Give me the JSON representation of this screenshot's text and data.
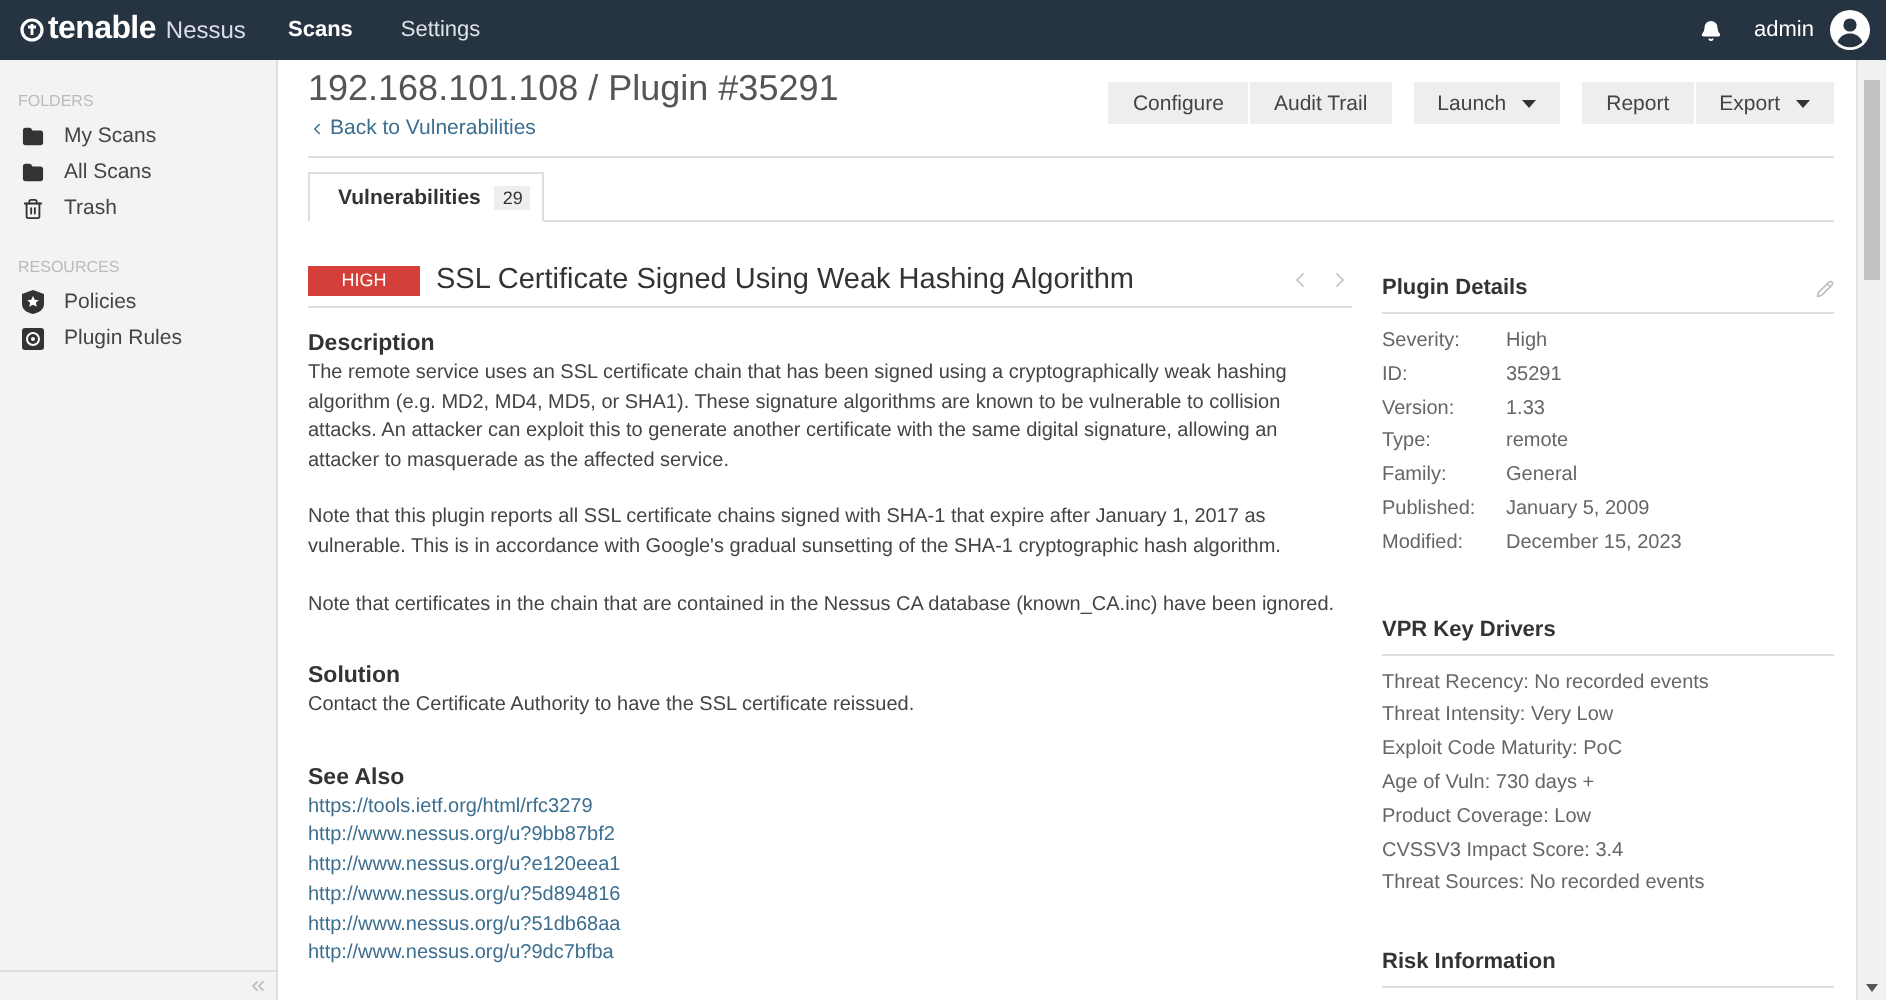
{
  "topbar": {
    "logo": {
      "brand": "tenable",
      "product": "Nessus"
    },
    "nav": [
      {
        "label": "Scans",
        "selected": true
      },
      {
        "label": "Settings",
        "selected": false
      }
    ],
    "user": "admin"
  },
  "sidebar": {
    "sections": [
      {
        "title": "FOLDERS",
        "items": [
          {
            "label": "My Scans",
            "kind": "folder"
          },
          {
            "label": "All Scans",
            "kind": "folder"
          },
          {
            "label": "Trash",
            "kind": "trash"
          }
        ]
      },
      {
        "title": "RESOURCES",
        "items": [
          {
            "label": "Policies",
            "kind": "shield"
          },
          {
            "label": "Plugin Rules",
            "kind": "rules"
          }
        ]
      }
    ]
  },
  "header": {
    "title": "192.168.101.108 / Plugin #35291",
    "back_link": "Back to Vulnerabilities",
    "button_groups": [
      [
        {
          "label": "Configure",
          "dropdown": false
        },
        {
          "label": "Audit Trail",
          "dropdown": false
        }
      ],
      [
        {
          "label": "Launch",
          "dropdown": true
        }
      ],
      [
        {
          "label": "Report",
          "dropdown": false
        },
        {
          "label": "Export",
          "dropdown": true
        }
      ]
    ]
  },
  "tabs": [
    {
      "label": "Vulnerabilities",
      "count": "29",
      "selected": true
    }
  ],
  "vulnerability": {
    "severity": "HIGH",
    "title": "SSL Certificate Signed Using Weak Hashing Algorithm",
    "sections": [
      {
        "heading": "Description",
        "kind": "text",
        "paragraphs": [
          "The remote service uses an SSL certificate chain that has been signed using a cryptographically weak hashing algorithm (e.g. MD2, MD4, MD5, or SHA1). These signature algorithms are known to be vulnerable to collision attacks. An attacker can exploit this to generate another certificate with the same digital signature, allowing an attacker to masquerade as the affected service.",
          "Note that this plugin reports all SSL certificate chains signed with SHA-1 that expire after January 1, 2017 as vulnerable. This is in accordance with Google's gradual sunsetting of the SHA-1 cryptographic hash algorithm.",
          "Note that certificates in the chain that are contained in the Nessus CA database (known_CA.inc) have been ignored."
        ]
      },
      {
        "heading": "Solution",
        "kind": "text",
        "paragraphs": [
          "Contact the Certificate Authority to have the SSL certificate reissued."
        ]
      },
      {
        "heading": "See Also",
        "kind": "links",
        "links": [
          "https://tools.ietf.org/html/rfc3279",
          "http://www.nessus.org/u?9bb87bf2",
          "http://www.nessus.org/u?e120eea1",
          "http://www.nessus.org/u?5d894816",
          "http://www.nessus.org/u?51db68aa",
          "http://www.nessus.org/u?9dc7bfba"
        ]
      }
    ]
  },
  "plugin_details": {
    "title": "Plugin Details",
    "rows": [
      {
        "label": "Severity:",
        "value": "High"
      },
      {
        "label": "ID:",
        "value": "35291"
      },
      {
        "label": "Version:",
        "value": "1.33"
      },
      {
        "label": "Type:",
        "value": "remote"
      },
      {
        "label": "Family:",
        "value": "General"
      },
      {
        "label": "Published:",
        "value": "January 5, 2009"
      },
      {
        "label": "Modified:",
        "value": "December 15, 2023"
      }
    ]
  },
  "vpr_key_drivers": {
    "title": "VPR Key Drivers",
    "lines": [
      "Threat Recency: No recorded events",
      "Threat Intensity: Very Low",
      "Exploit Code Maturity: PoC",
      "Age of Vuln: 730 days +",
      "Product Coverage: Low",
      "CVSSV3 Impact Score: 3.4",
      "Threat Sources: No recorded events"
    ]
  },
  "risk_information": {
    "title": "Risk Information"
  }
}
